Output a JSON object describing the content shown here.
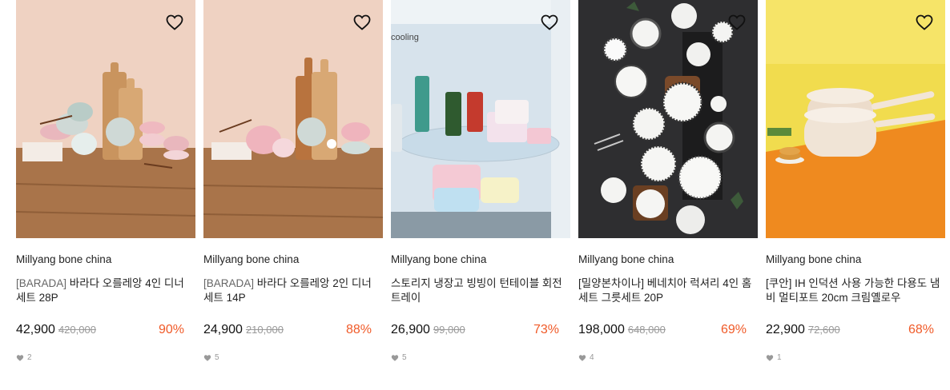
{
  "products": [
    {
      "brand": "Millyang bone china",
      "title_tag": "[BARADA]",
      "title": " 바라다 오를레앙 4인 디너세트 28P",
      "price": "42,900",
      "original_price": "420,000",
      "discount": "90%",
      "likes": "2"
    },
    {
      "brand": "Millyang bone china",
      "title_tag": "[BARADA]",
      "title": " 바라다 오를레앙 2인 디너세트 14P",
      "price": "24,900",
      "original_price": "210,000",
      "discount": "88%",
      "likes": "5"
    },
    {
      "brand": "Millyang bone china",
      "title_tag": "",
      "title": "스토리지 냉장고 빙빙이 턴테이블 회전트레이",
      "price": "26,900",
      "original_price": "99,000",
      "discount": "73%",
      "likes": "5",
      "image_text": "cooling"
    },
    {
      "brand": "Millyang bone china",
      "title_tag": "",
      "title": "[밀양본차이나] 베네치아 럭셔리 4인 홈세트 그릇세트 20P",
      "price": "198,000",
      "original_price": "648,000",
      "discount": "69%",
      "likes": "4"
    },
    {
      "brand": "Millyang bone china",
      "title_tag": "",
      "title": "[쿠안] IH 인덕션 사용 가능한 다용도 냄비 멀티포트 20cm 크림옐로우",
      "price": "22,900",
      "original_price": "72,600",
      "discount": "68%",
      "likes": "1"
    }
  ],
  "colors": {
    "discount": "#f05a28",
    "muted": "#999999"
  },
  "icons": {
    "wishlist": "heart-outline-icon",
    "likes": "heart-filled-icon"
  }
}
